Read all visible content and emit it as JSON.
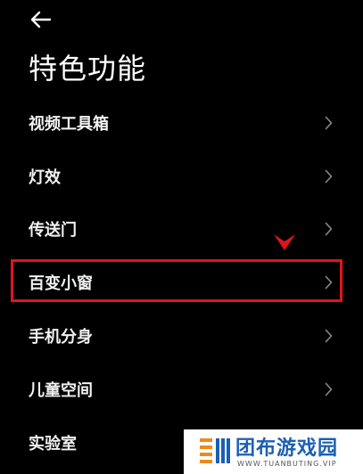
{
  "header": {
    "back_icon": "arrow-left-icon",
    "title": "特色功能"
  },
  "menu": {
    "items": [
      {
        "label": "视频工具箱",
        "icon": "chevron-right-icon"
      },
      {
        "label": "灯效",
        "icon": "chevron-right-icon"
      },
      {
        "label": "传送门",
        "icon": "chevron-right-icon"
      },
      {
        "label": "百变小窗",
        "icon": "chevron-right-icon"
      },
      {
        "label": "手机分身",
        "icon": "chevron-right-icon"
      },
      {
        "label": "儿童空间",
        "icon": "chevron-right-icon"
      },
      {
        "label": "实验室",
        "icon": "chevron-right-icon"
      }
    ]
  },
  "annotation": {
    "highlight_color": "#e1141b",
    "pointer_icon": "down-pointer-icon"
  },
  "watermark": {
    "name": "团布游戏园",
    "url": "WWW.TUANBUTING.VIP",
    "color": "#1a5fb4"
  },
  "colors": {
    "background": "#000000",
    "text": "#ffffff",
    "chevron": "#8a8a8a"
  }
}
